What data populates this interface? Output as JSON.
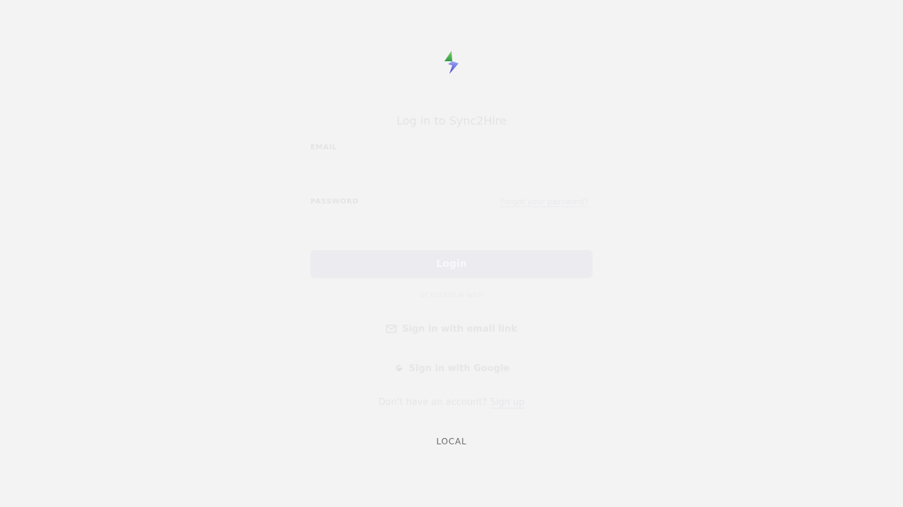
{
  "brand": {
    "name": "Sync2Hire",
    "logo_icon": "lightning-bolt-logo",
    "logo_colors": [
      "#62c34d",
      "#6b7be8",
      "#4a4fd6"
    ]
  },
  "login": {
    "title": "Log in to Sync2Hire",
    "email_label": "EMAIL",
    "email_placeholder": "",
    "password_label": "PASSWORD",
    "forgot_password": "Forgot your password?",
    "login_button": "Login",
    "divider_text": "or continue with"
  },
  "alternatives": {
    "email_link": {
      "label": "Sign in with email link",
      "icon": "mail-icon"
    },
    "google": {
      "label": "Sign in with Google",
      "icon": "google-icon"
    }
  },
  "signup": {
    "prompt": "Don't have an account?",
    "link_label": "Sign up"
  },
  "environment": {
    "label": "LOCAL"
  }
}
